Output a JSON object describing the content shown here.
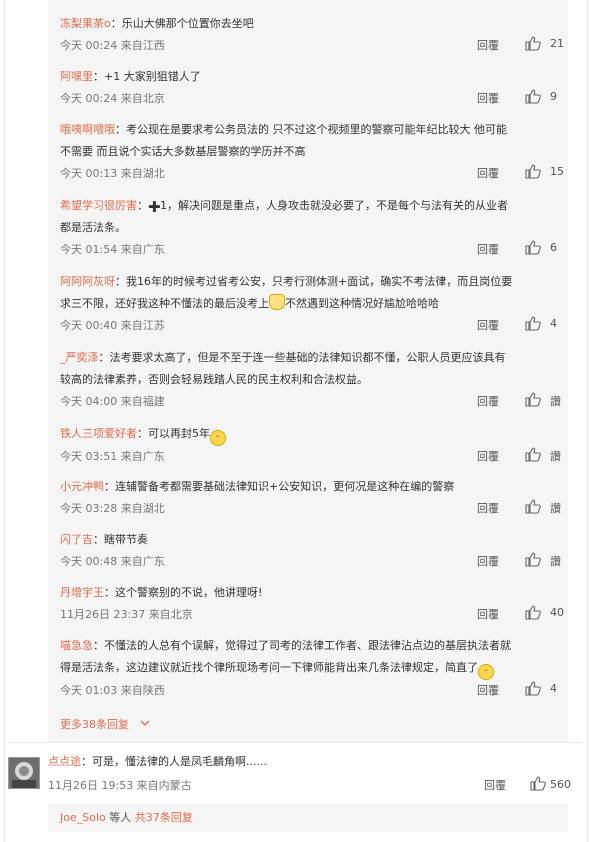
{
  "replies": [
    {
      "user": "冻梨果茶o",
      "text": "乐山大佛那个位置你去坐吧",
      "time": "今天 00:24 来自江西",
      "reply_label": "回覆",
      "likes": "21"
    },
    {
      "user": "阿嘿里",
      "text": "+1 大家别狙错人了",
      "time": "今天 00:24 来自北京",
      "reply_label": "回覆",
      "likes": "9"
    },
    {
      "user": "哦咦啊喂哦",
      "text_line1": "考公现在是要求考公务员法的 只不过这个视频里的警察可能年纪比较大 他可能",
      "text_line2": "不需要 而且说个实话大多数基层警察的学历并不高",
      "time": "今天 00:13 来自湖北",
      "reply_label": "回覆",
      "likes": "15"
    },
    {
      "user": "希望学习很厉害",
      "text_line1": "1，解决问题是重点，人身攻击就没必要了，不是每个与法有关的从业者",
      "text_line2": "都是活法条。",
      "time": "今天 01:54 来自广东",
      "reply_label": "回覆",
      "likes": "6"
    },
    {
      "user": "阿阿阿灰呀",
      "text_line1": "我16年的时候考过省考公安，只考行测体测+面试，确实不考法律，而且岗位要",
      "text_line2a": "求三不限，还好我这种不懂法的最后没考上",
      "text_line2b": "不然遇到这种情况好尴尬哈哈哈",
      "time": "今天 00:40 来自江苏",
      "reply_label": "回覆",
      "likes": "4"
    },
    {
      "user": "_严奕泽",
      "text_line1": "法考要求太高了，但是不至于连一些基础的法律知识都不懂，公职人员更应该具有",
      "text_line2": "较高的法律素养，否则会轻易践踏人民的民主权利和合法权益。",
      "time": "今天 04:00 来自福建",
      "reply_label": "回覆",
      "likes": "讚"
    },
    {
      "user": "铁人三项爱好者",
      "text": "可以再封5年",
      "time": "今天 03:51 来自广东",
      "reply_label": "回覆",
      "likes": "讚"
    },
    {
      "user": "小元冲鸭",
      "text": "连辅警备考都需要基础法律知识+公安知识，更何况是这种在编的警察",
      "time": "今天 03:28 来自湖北",
      "reply_label": "回覆",
      "likes": "讚"
    },
    {
      "user": "闪了吉",
      "text": "瞎带节奏",
      "time": "今天 00:48 来自广东",
      "reply_label": "回覆",
      "likes": "讚"
    },
    {
      "user": "丹增宇王",
      "text": "这个警察别的不说，他讲理呀!",
      "time": "11月26日 23:37 来自北京",
      "reply_label": "回覆",
      "likes": "40"
    },
    {
      "user": "喵急急",
      "text_line1": "不懂法的人总有个误解，觉得过了司考的法律工作者、跟法律沾点边的基层执法者就",
      "text_line2": "得是活法条，这边建议就近找个律所现场考问一下律师能背出来几条法律规定，简直了",
      "time": "今天 01:03 来自陕西",
      "reply_label": "回覆",
      "likes": "4"
    }
  ],
  "more_replies": "更多38条回复",
  "main_comment": {
    "user": "点点途",
    "text": "可是，懂法律的人是凤毛麟角啊......",
    "time": "11月26日 19:53 来自内蒙古",
    "reply_label": "回覆",
    "likes": "560"
  },
  "sub_summary": {
    "user": "Joe_Solo",
    "mid": "等人",
    "link": "共37条回复"
  },
  "colors": {
    "username": "#e86b4b",
    "background_reply": "#f5f5f5",
    "text": "#333333",
    "meta": "#777777"
  },
  "icons": [
    "thumb-up-icon",
    "chevron-down-icon",
    "avatar",
    "emoji-grin-icon",
    "emoji-person-icon",
    "cross-plus-icon"
  ]
}
